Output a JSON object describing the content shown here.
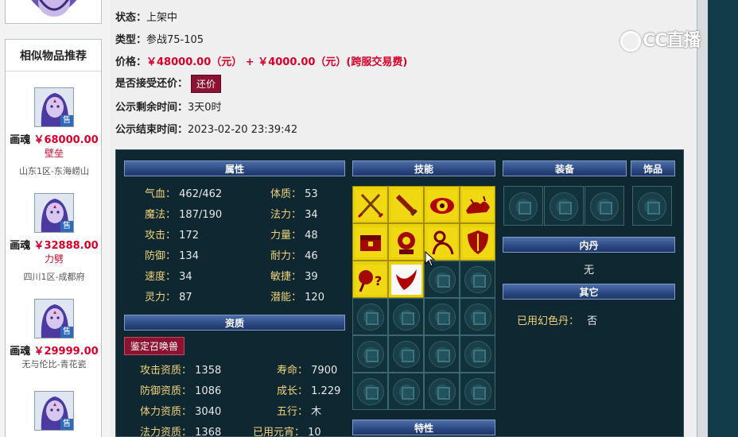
{
  "sidebar": {
    "title": "相似物品推荐",
    "sale_tag": "售",
    "items": [
      {
        "name": "画魂",
        "price": "￥68000.00",
        "sub": "壁垒",
        "server": "山东1区-东海崂山"
      },
      {
        "name": "画魂",
        "price": "￥32888.00",
        "sub": "力劈",
        "server": "四川1区-成都府"
      },
      {
        "name": "画魂",
        "price": "￥29999.00",
        "sub": "",
        "server": "无与伦比-青花瓷"
      },
      {
        "name": "",
        "price": "",
        "sub": "",
        "server": ""
      }
    ]
  },
  "info": {
    "status_label": "状态：",
    "status_value": "上架中",
    "type_label": "类型：",
    "type_value": "参战75-105",
    "price_label": "价格：",
    "price_value": "￥48000.00（元） + ￥4000.00（元）(跨服交易费)",
    "counter_label": "是否接受还价：",
    "counter_button": "还价",
    "remain_label": "公示剩余时间：",
    "remain_value": "3天0时",
    "end_label": "公示结束时间：",
    "end_value": "2023-02-20 23:39:42"
  },
  "watermark": "CC直播",
  "panel": {
    "headers": {
      "attributes": "属性",
      "skills": "技能",
      "equipment": "装备",
      "accessory": "饰品",
      "aptitude": "资质",
      "inner_dan": "内丹",
      "other": "其它",
      "traits": "特性"
    },
    "attributes": [
      {
        "label": "气血：",
        "value": "462/462"
      },
      {
        "label": "体质：",
        "value": "53"
      },
      {
        "label": "魔法：",
        "value": "187/190"
      },
      {
        "label": "法力：",
        "value": "34"
      },
      {
        "label": "攻击：",
        "value": "172"
      },
      {
        "label": "力量：",
        "value": "48"
      },
      {
        "label": "防御：",
        "value": "134"
      },
      {
        "label": "耐力：",
        "value": "46"
      },
      {
        "label": "速度：",
        "value": "34"
      },
      {
        "label": "敏捷：",
        "value": "39"
      },
      {
        "label": "灵力：",
        "value": "87"
      },
      {
        "label": "潜能：",
        "value": "120"
      }
    ],
    "appraise_button": "鉴定召唤兽",
    "aptitudes": [
      {
        "label": "攻击资质：",
        "value": "1358"
      },
      {
        "label": "寿命：",
        "value": "7900"
      },
      {
        "label": "防御资质：",
        "value": "1086"
      },
      {
        "label": "成长：",
        "value": "1.229"
      },
      {
        "label": "体力资质：",
        "value": "3040"
      },
      {
        "label": "五行：",
        "value": "木"
      },
      {
        "label": "法力资质：",
        "value": "1368"
      },
      {
        "label": "已用元宵：",
        "value": "10"
      }
    ],
    "inner_dan_value": "无",
    "other_label": "已用幻色丹：",
    "other_value": "否",
    "skill_icons": [
      "crossed-swords-icon",
      "sword-icon",
      "eye-icon",
      "beast-icon",
      "chest-icon",
      "gear-orb-icon",
      "person-icon",
      "shield-icon",
      "question-orb-icon",
      "red-strike-icon"
    ]
  }
}
